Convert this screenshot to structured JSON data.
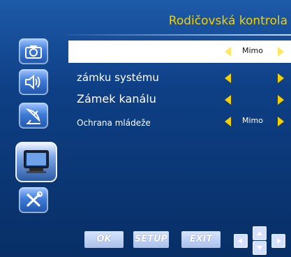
{
  "title": "Rodičovská kontrola",
  "sidebar": {
    "items": [
      {
        "icon": "camera-icon"
      },
      {
        "icon": "speaker-icon"
      },
      {
        "icon": "satellite-dish-icon"
      },
      {
        "icon": "tv-icon"
      },
      {
        "icon": "tools-icon"
      }
    ]
  },
  "menu": {
    "rows": [
      {
        "label": "",
        "value": "Mimo"
      },
      {
        "label": "zámku systému",
        "value": ""
      },
      {
        "label": "Zámek kanálu",
        "value": ""
      },
      {
        "label": "Ochrana mládeže",
        "value": "Mimo"
      }
    ]
  },
  "footer": {
    "ok": "OK",
    "setup": "SETUP",
    "exit": "EXIT"
  },
  "colors": {
    "accent": "#f5d000",
    "background": "#0e3f85",
    "selected_row": "#ffffff"
  }
}
